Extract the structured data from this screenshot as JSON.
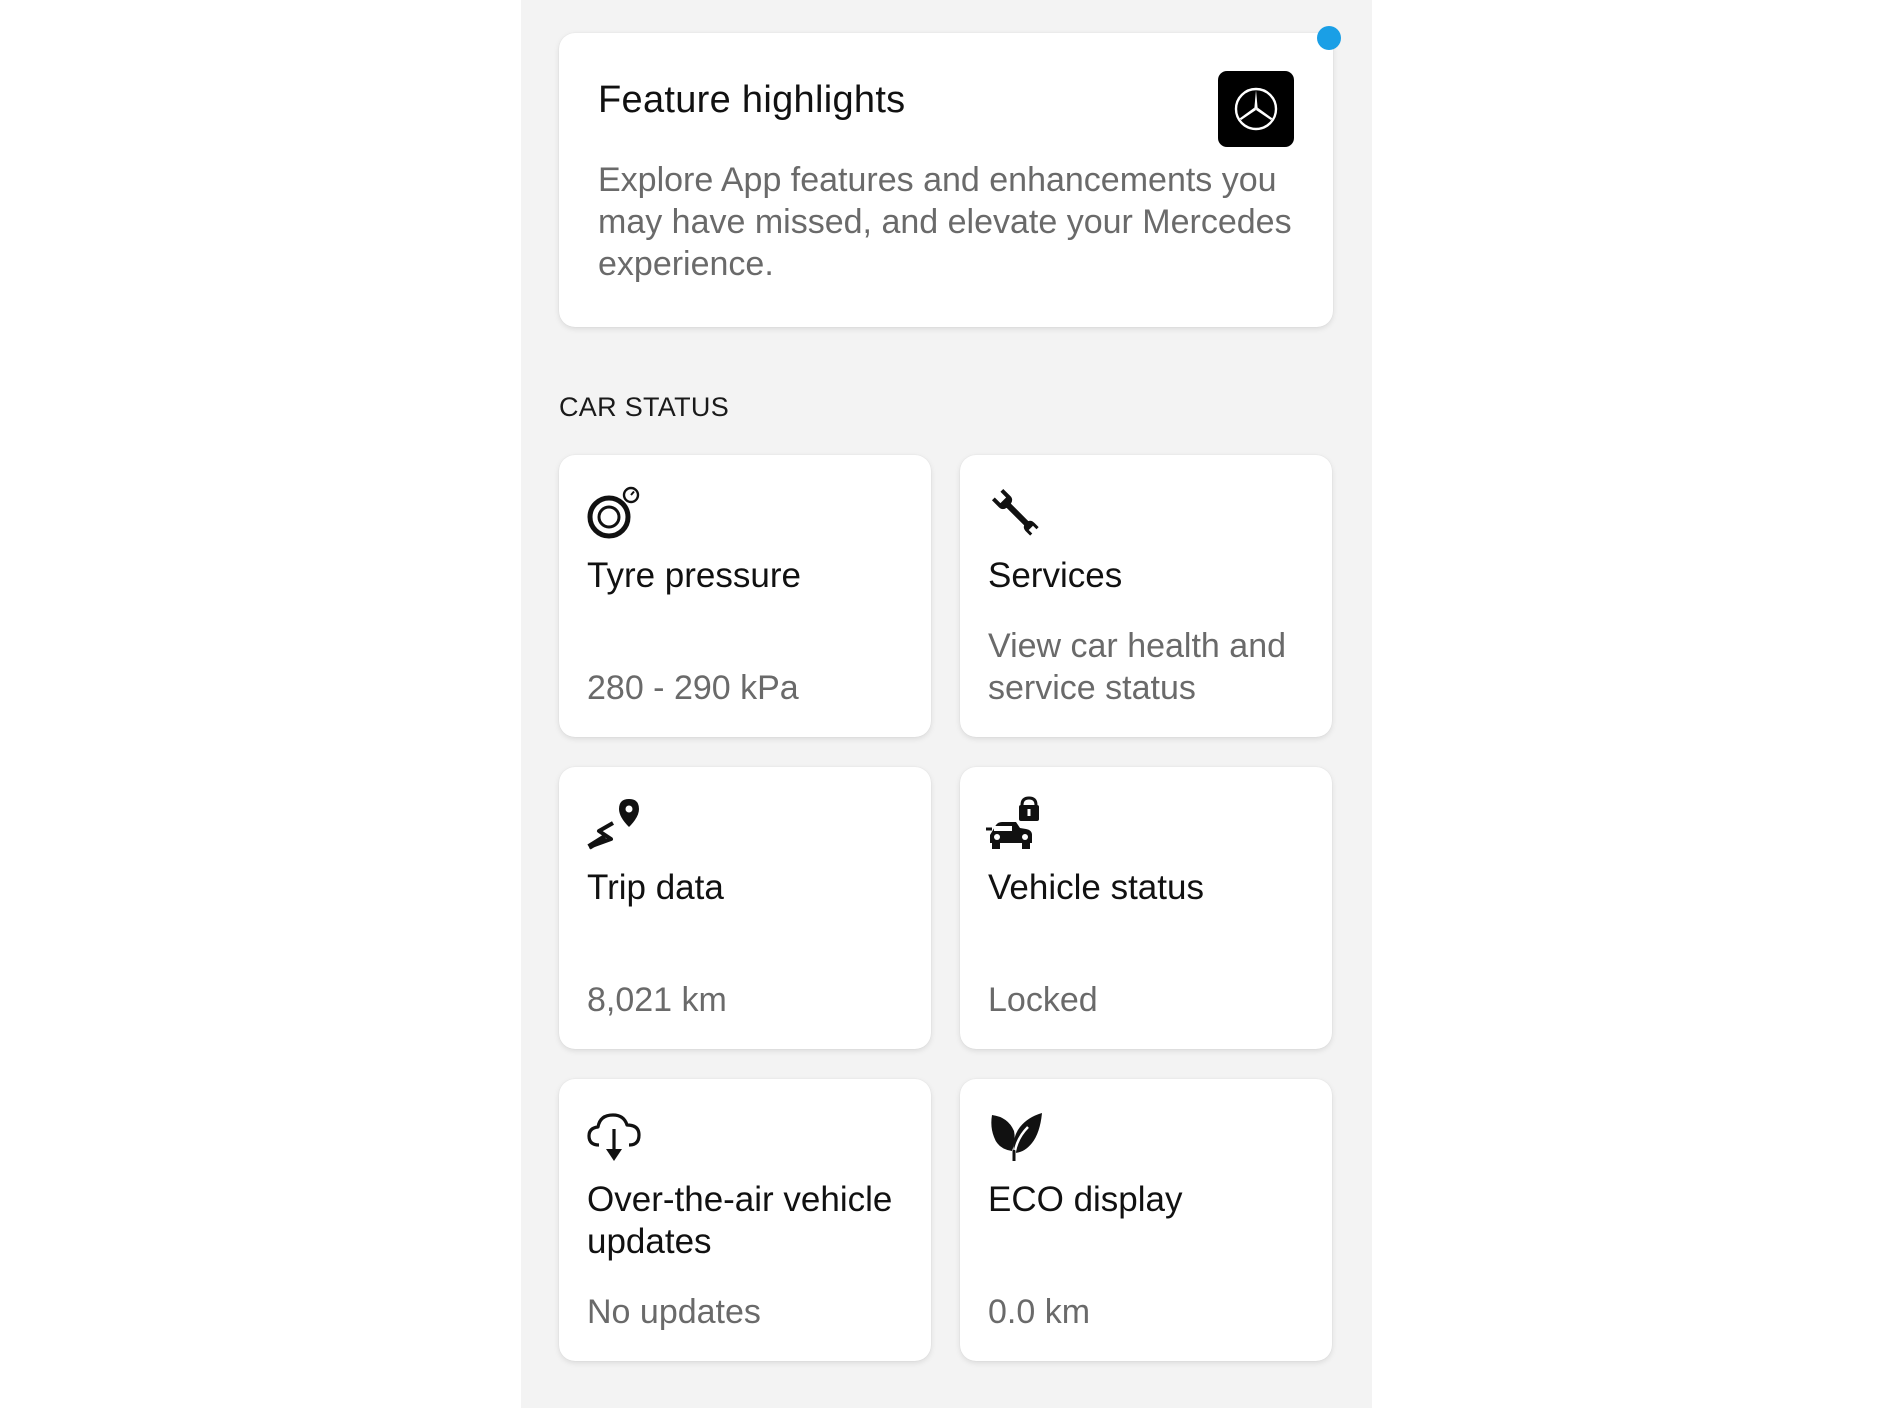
{
  "feature_highlights": {
    "title": "Feature highlights",
    "description": "Explore App features and enhancements you may have missed, and elevate your Mercedes experience.",
    "logo_icon": "mercedes-star-icon"
  },
  "notification_dot_color": "#1a9fe6",
  "car_status": {
    "section_title": "CAR STATUS",
    "tiles": [
      {
        "icon": "tyre-pressure-icon",
        "title": "Tyre pressure",
        "subtitle": "280 - 290 kPa"
      },
      {
        "icon": "wrench-icon",
        "title": "Services",
        "subtitle": "View car health and service status"
      },
      {
        "icon": "route-pin-icon",
        "title": "Trip data",
        "subtitle": "8,021 km"
      },
      {
        "icon": "car-lock-icon",
        "title": "Vehicle status",
        "subtitle": "Locked"
      },
      {
        "icon": "cloud-download-icon",
        "title": "Over-the-air vehicle updates",
        "subtitle": "No updates"
      },
      {
        "icon": "leaf-icon",
        "title": "ECO display",
        "subtitle": "0.0 km"
      }
    ]
  }
}
